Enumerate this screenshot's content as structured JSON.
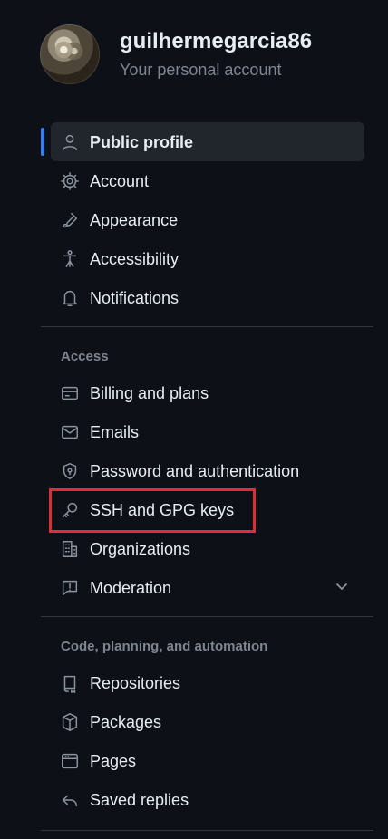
{
  "account": {
    "username": "guilhermegarcia86",
    "type": "Your personal account"
  },
  "nav": {
    "primary": [
      {
        "label": "Public profile",
        "icon": "person-icon",
        "active": true
      },
      {
        "label": "Account",
        "icon": "gear-icon",
        "active": false
      },
      {
        "label": "Appearance",
        "icon": "paintbrush-icon",
        "active": false
      },
      {
        "label": "Accessibility",
        "icon": "accessibility-icon",
        "active": false
      },
      {
        "label": "Notifications",
        "icon": "bell-icon",
        "active": false
      }
    ],
    "sections": [
      {
        "heading": "Access",
        "items": [
          {
            "label": "Billing and plans",
            "icon": "credit-card-icon"
          },
          {
            "label": "Emails",
            "icon": "mail-icon"
          },
          {
            "label": "Password and authentication",
            "icon": "shield-lock-icon"
          },
          {
            "label": "SSH and GPG keys",
            "icon": "key-icon",
            "highlighted": true
          },
          {
            "label": "Organizations",
            "icon": "organization-icon"
          },
          {
            "label": "Moderation",
            "icon": "report-icon",
            "expandable": true
          }
        ]
      },
      {
        "heading": "Code, planning, and automation",
        "items": [
          {
            "label": "Repositories",
            "icon": "repo-icon"
          },
          {
            "label": "Packages",
            "icon": "package-icon"
          },
          {
            "label": "Pages",
            "icon": "browser-icon"
          },
          {
            "label": "Saved replies",
            "icon": "reply-icon"
          }
        ]
      }
    ]
  },
  "colors": {
    "background": "#0d1117",
    "active_background": "#21262d",
    "active_marker": "#2f81f7",
    "highlight_border": "#e12d35",
    "text": "#e6edf3",
    "muted_text": "#7d8590",
    "divider": "#30363d"
  }
}
